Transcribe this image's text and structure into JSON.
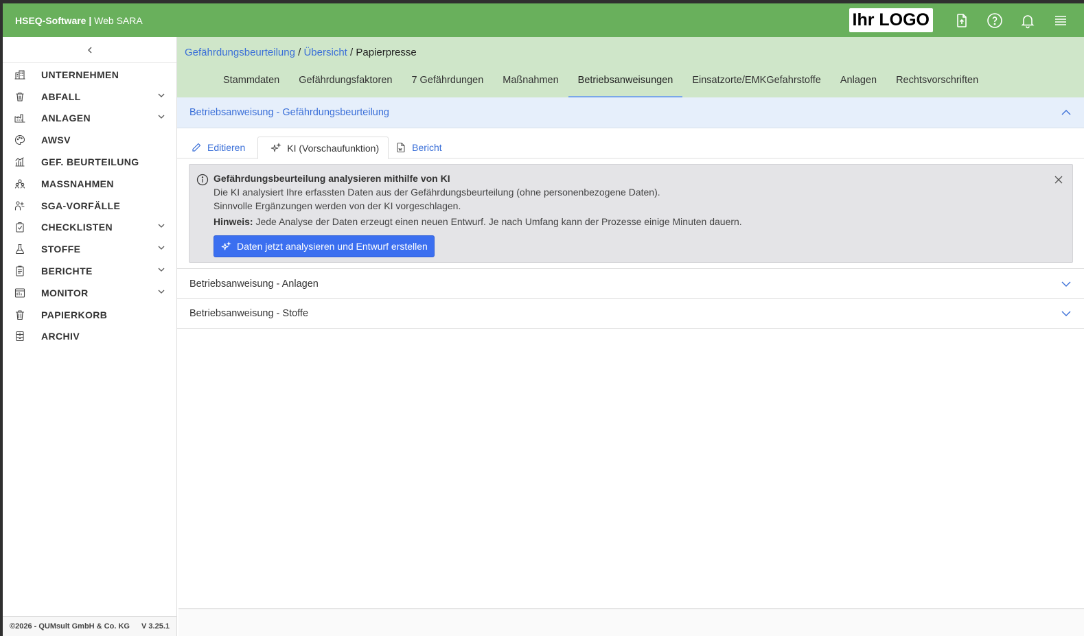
{
  "app": {
    "brand_bold": "HSEQ-Software |",
    "brand_light": " Web SARA",
    "logo_text": "Ihr LOGO"
  },
  "topbar": {
    "icons": [
      "upload-icon",
      "help-icon",
      "bell-icon",
      "menu-icon"
    ]
  },
  "sidebar": {
    "items": [
      {
        "label": "UNTERNEHMEN",
        "icon": "building-icon",
        "expandable": false
      },
      {
        "label": "ABFALL",
        "icon": "waste-icon",
        "expandable": true
      },
      {
        "label": "ANLAGEN",
        "icon": "factory-icon",
        "expandable": true
      },
      {
        "label": "AWSV",
        "icon": "palette-icon",
        "expandable": false
      },
      {
        "label": "GEF. BEURTEILUNG",
        "icon": "chart-icon",
        "expandable": false
      },
      {
        "label": "MASSNAHMEN",
        "icon": "team-icon",
        "expandable": false
      },
      {
        "label": "SGA-VORFÄLLE",
        "icon": "incident-icon",
        "expandable": false
      },
      {
        "label": "CHECKLISTEN",
        "icon": "clipboard-icon",
        "expandable": true
      },
      {
        "label": "STOFFE",
        "icon": "flask-icon",
        "expandable": true
      },
      {
        "label": "BERICHTE",
        "icon": "report-icon",
        "expandable": true
      },
      {
        "label": "MONITOR",
        "icon": "monitor-icon",
        "expandable": true
      },
      {
        "label": "PAPIERKORB",
        "icon": "trash-icon",
        "expandable": false
      },
      {
        "label": "ARCHIV",
        "icon": "archive-icon",
        "expandable": false
      }
    ],
    "footer_copyright": "©2026 - QUMsult GmbH & Co. KG",
    "footer_version": "V 3.25.1"
  },
  "breadcrumb": {
    "part1": "Gefährdungsbeurteilung",
    "sep1": " / ",
    "part2": "Übersicht",
    "sep2": " / ",
    "current": "Papierpresse"
  },
  "tabs": [
    {
      "label": "Stammdaten",
      "active": false
    },
    {
      "label": "Gefährdungsfaktoren",
      "active": false
    },
    {
      "label": "7 Gefährdungen",
      "active": false
    },
    {
      "label": "Maßnahmen",
      "active": false
    },
    {
      "label": "Betriebsanweisungen",
      "active": true
    },
    {
      "label": "Einsatzorte/EMKGefahrstoffe",
      "active": false
    },
    {
      "label": "Anlagen",
      "active": false
    },
    {
      "label": "Rechtsvorschriften",
      "active": false
    }
  ],
  "accordion": {
    "open_title": "Betriebsanweisung - Gefährdungsbeurteilung",
    "subtabs": {
      "edit": "Editieren",
      "ai": "KI (Vorschaufunktion)",
      "report": "Bericht"
    },
    "info": {
      "title": "Gefährdungsbeurteilung analysieren mithilfe von KI",
      "line1": "Die KI analysiert Ihre erfassten Daten aus der Gefährdungsbeurteilung (ohne personenbezogene Daten).",
      "line2": "Sinnvolle Ergänzungen werden von der KI vorgeschlagen.",
      "hint_label": "Hinweis:",
      "hint_text": " Jede Analyse der Daten erzeugt einen neuen Entwurf. Je nach Umfang kann der Prozesse einige Minuten dauern.",
      "button": "Daten jetzt analysieren und Entwurf erstellen"
    },
    "row2": "Betriebsanweisung - Anlagen",
    "row3": "Betriebsanweisung - Stoffe"
  }
}
